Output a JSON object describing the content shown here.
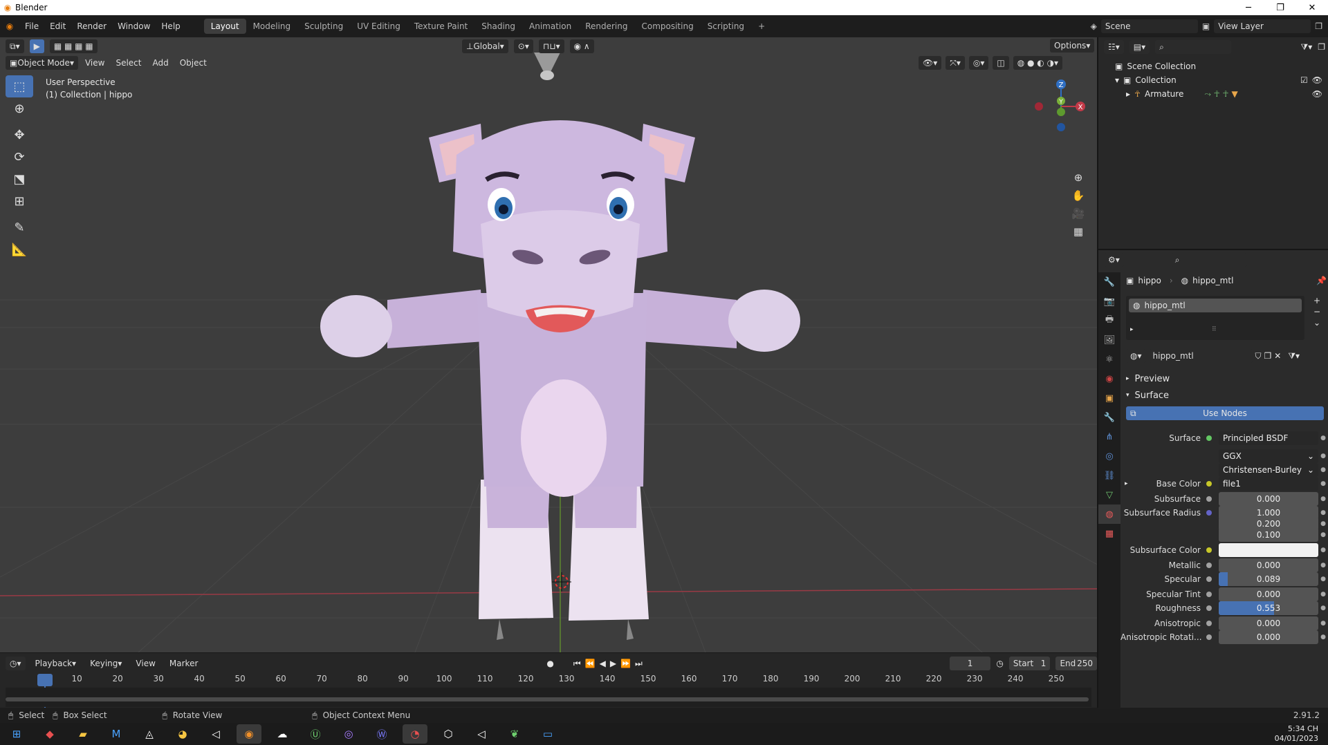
{
  "window": {
    "title": "Blender",
    "minimize": "─",
    "maximize": "❐",
    "close": "✕"
  },
  "menu": {
    "items": [
      "File",
      "Edit",
      "Render",
      "Window",
      "Help"
    ]
  },
  "workspaces": {
    "tabs": [
      "Layout",
      "Modeling",
      "Sculpting",
      "UV Editing",
      "Texture Paint",
      "Shading",
      "Animation",
      "Rendering",
      "Compositing",
      "Scripting"
    ],
    "active": "Layout",
    "add": "+"
  },
  "scene": {
    "name": "Scene",
    "view_layer": "View Layer"
  },
  "viewport": {
    "mode": "Object Mode",
    "menus": [
      "View",
      "Select",
      "Add",
      "Object"
    ],
    "orientation": "Global",
    "options": "Options",
    "info_line1": "User Perspective",
    "info_line2": "(1) Collection | hippo",
    "gizmo": {
      "z": "Z",
      "y": "Y",
      "x": "X"
    }
  },
  "timeline": {
    "menus": [
      "Playback",
      "Keying",
      "View",
      "Marker"
    ],
    "current_frame": "1",
    "start_label": "Start",
    "start": "1",
    "end_label": "End",
    "end": "250",
    "ticks": [
      "1",
      "10",
      "20",
      "30",
      "40",
      "50",
      "60",
      "70",
      "80",
      "90",
      "100",
      "110",
      "120",
      "130",
      "140",
      "150",
      "160",
      "170",
      "180",
      "190",
      "200",
      "210",
      "220",
      "230",
      "240",
      "250"
    ]
  },
  "statusbar": {
    "select": "Select",
    "box_select": "Box Select",
    "rotate": "Rotate View",
    "context": "Object Context Menu",
    "version": "2.91.2"
  },
  "outliner": {
    "scene_collection": "Scene Collection",
    "collection": "Collection",
    "armature": "Armature"
  },
  "properties": {
    "breadcrumb_object": "hippo",
    "breadcrumb_material": "hippo_mtl",
    "slot": "hippo_mtl",
    "material_name": "hippo_mtl",
    "preview": "Preview",
    "surface_panel": "Surface",
    "use_nodes": "Use Nodes",
    "rows": [
      {
        "label": "Surface",
        "value": "Principled BSDF",
        "socket": "#63c763",
        "kind": "dark"
      },
      {
        "label": "",
        "value": "GGX",
        "socket": "",
        "kind": "select"
      },
      {
        "label": "",
        "value": "Christensen-Burley",
        "socket": "",
        "kind": "select"
      },
      {
        "label": "Base Color",
        "value": "file1",
        "socket": "#c7c729",
        "kind": "dark"
      },
      {
        "label": "Subsurface",
        "value": "0.000",
        "socket": "#a1a1a1",
        "kind": "num"
      },
      {
        "label": "Subsurface Radius",
        "value": "1.000",
        "socket": "#6363c7",
        "kind": "num"
      },
      {
        "label": "",
        "value": "0.200",
        "socket": "",
        "kind": "num"
      },
      {
        "label": "",
        "value": "0.100",
        "socket": "",
        "kind": "num"
      },
      {
        "label": "Subsurface Color",
        "value": "",
        "socket": "#c7c729",
        "kind": "color"
      },
      {
        "label": "Metallic",
        "value": "0.000",
        "socket": "#a1a1a1",
        "kind": "num"
      },
      {
        "label": "Specular",
        "value": "0.089",
        "socket": "#a1a1a1",
        "kind": "num",
        "fill": 0.089
      },
      {
        "label": "Specular Tint",
        "value": "0.000",
        "socket": "#a1a1a1",
        "kind": "num"
      },
      {
        "label": "Roughness",
        "value": "0.553",
        "socket": "#a1a1a1",
        "kind": "num",
        "fill": 0.553
      },
      {
        "label": "Anisotropic",
        "value": "0.000",
        "socket": "#a1a1a1",
        "kind": "num"
      },
      {
        "label": "Anisotropic Rotati...",
        "value": "0.000",
        "socket": "#a1a1a1",
        "kind": "num"
      }
    ]
  },
  "taskbar": {
    "time": "5:34 CH",
    "date": "04/01/2023"
  },
  "colors": {
    "accent": "#4772b3",
    "header": "#1d1d1d",
    "viewport": "#3d3d3d",
    "hippo": "#d9c9e6"
  }
}
